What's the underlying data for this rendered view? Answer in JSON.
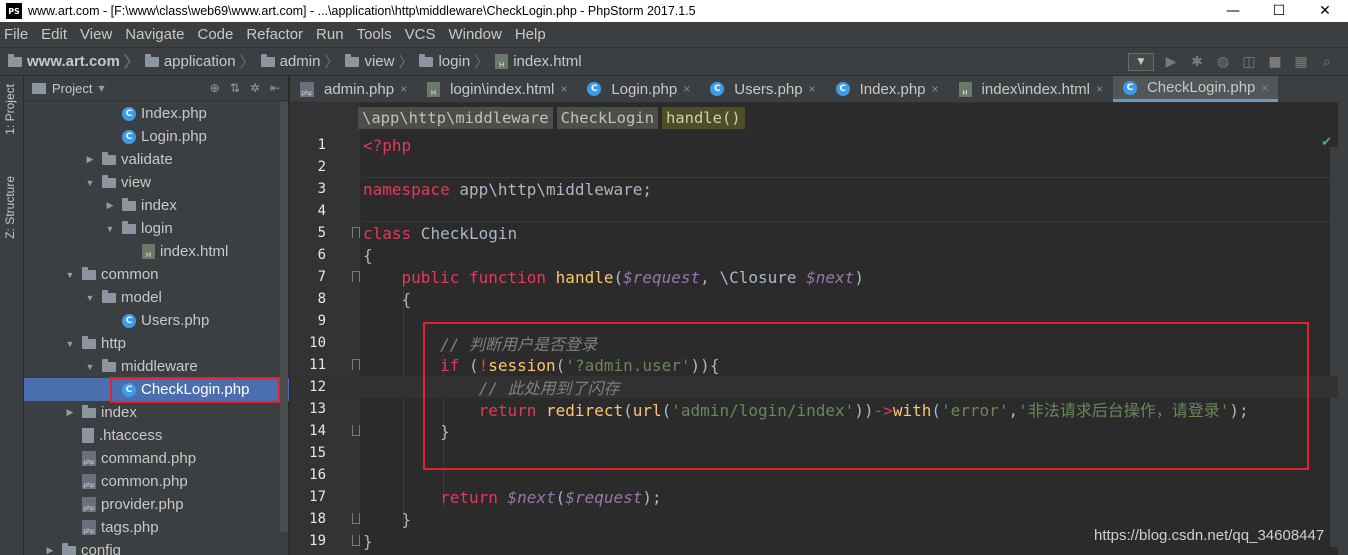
{
  "window": {
    "title": "www.art.com - [F:\\www\\class\\web69\\www.art.com] - ...\\application\\http\\middleware\\CheckLogin.php - PhpStorm 2017.1.5",
    "logo": "PS",
    "minimize": "—",
    "maximize": "☐",
    "close": "✕"
  },
  "menu": [
    "File",
    "Edit",
    "View",
    "Navigate",
    "Code",
    "Refactor",
    "Run",
    "Tools",
    "VCS",
    "Window",
    "Help"
  ],
  "navbar": {
    "crumbs": [
      "www.art.com",
      "application",
      "admin",
      "view",
      "login",
      "index.html"
    ]
  },
  "left_tabs": {
    "project": "1: Project",
    "structure": "Z: Structure"
  },
  "project_panel": {
    "title": "Project",
    "tree": [
      {
        "label": "Index.php",
        "icon": "class-icon",
        "depth": 5,
        "toggle": ""
      },
      {
        "label": "Login.php",
        "icon": "class-icon",
        "depth": 5,
        "toggle": ""
      },
      {
        "label": "validate",
        "icon": "folder-icon",
        "depth": 4,
        "toggle": "▶"
      },
      {
        "label": "view",
        "icon": "folder-icon",
        "depth": 4,
        "toggle": "▼"
      },
      {
        "label": "index",
        "icon": "folder-icon",
        "depth": 5,
        "toggle": "▶"
      },
      {
        "label": "login",
        "icon": "folder-icon",
        "depth": 5,
        "toggle": "▼"
      },
      {
        "label": "index.html",
        "icon": "html-icon",
        "depth": 6,
        "toggle": ""
      },
      {
        "label": "common",
        "icon": "folder-icon",
        "depth": 3,
        "toggle": "▼"
      },
      {
        "label": "model",
        "icon": "folder-icon",
        "depth": 4,
        "toggle": "▼"
      },
      {
        "label": "Users.php",
        "icon": "class-icon",
        "depth": 5,
        "toggle": ""
      },
      {
        "label": "http",
        "icon": "folder-icon",
        "depth": 3,
        "toggle": "▼"
      },
      {
        "label": "middleware",
        "icon": "folder-icon",
        "depth": 4,
        "toggle": "▼"
      },
      {
        "label": "CheckLogin.php",
        "icon": "class-icon",
        "depth": 5,
        "toggle": "",
        "selected": true
      },
      {
        "label": "index",
        "icon": "folder-icon",
        "depth": 3,
        "toggle": "▶"
      },
      {
        "label": ".htaccess",
        "icon": "file-icon",
        "depth": 3,
        "toggle": ""
      },
      {
        "label": "command.php",
        "icon": "php-icon",
        "depth": 3,
        "toggle": ""
      },
      {
        "label": "common.php",
        "icon": "php-icon",
        "depth": 3,
        "toggle": ""
      },
      {
        "label": "provider.php",
        "icon": "php-icon",
        "depth": 3,
        "toggle": ""
      },
      {
        "label": "tags.php",
        "icon": "php-icon",
        "depth": 3,
        "toggle": ""
      },
      {
        "label": "config",
        "icon": "folder-icon",
        "depth": 2,
        "toggle": "▶"
      }
    ]
  },
  "tabs": [
    {
      "label": "admin.php",
      "icon": "php-icon"
    },
    {
      "label": "login\\index.html",
      "icon": "html-icon"
    },
    {
      "label": "Login.php",
      "icon": "class-icon"
    },
    {
      "label": "Users.php",
      "icon": "class-icon"
    },
    {
      "label": "Index.php",
      "icon": "class-icon"
    },
    {
      "label": "index\\index.html",
      "icon": "html-icon"
    },
    {
      "label": "CheckLogin.php",
      "icon": "class-icon",
      "active": true
    }
  ],
  "editor_breadcrumbs": [
    "\\app\\http\\middleware",
    "CheckLogin",
    "handle()"
  ],
  "code_lines": [
    "1",
    "2",
    "3",
    "4",
    "5",
    "6",
    "7",
    "8",
    "9",
    "10",
    "11",
    "12",
    "13",
    "14",
    "15",
    "16",
    "17",
    "18",
    "19"
  ],
  "code": {
    "l1": "<?php",
    "l3_kw": "namespace",
    "l3_rest": " app\\http\\middleware;",
    "l5_kw": "class",
    "l5_rest": " CheckLogin",
    "l6": "{",
    "l7_kw1": "public",
    "l7_kw2": "function",
    "l7_fn": "handle",
    "l7_p1": "(",
    "l7_v1": "$request",
    "l7_p2": ", \\Closure ",
    "l7_v2": "$next",
    "l7_p3": ")",
    "l8": "{",
    "l10": "// 判断用户是否登录",
    "l11_kw": "if",
    "l11_p1": " (",
    "l11_neg": "!",
    "l11_fn": "session",
    "l11_p2": "(",
    "l11_str": "'?admin.user'",
    "l11_p3": ")){",
    "l12": "// 此处用到了闪存",
    "l13_kw": "return",
    "l13_fn1": "redirect",
    "l13_p1": "(",
    "l13_fn2": "url",
    "l13_p2": "(",
    "l13_str1": "'admin/login/index'",
    "l13_p3": "))",
    "l13_arrow": "->",
    "l13_fn3": "with",
    "l13_p4": "(",
    "l13_str2": "'error'",
    "l13_p5": ",",
    "l13_str3": "'非法请求后台操作，请登录'",
    "l13_p6": ");",
    "l14": "}",
    "l17_kw": "return",
    "l17_v1": "$next",
    "l17_p1": "(",
    "l17_v2": "$request",
    "l17_p2": ");",
    "l18": "}",
    "l19": "}"
  },
  "watermark": "https://blog.csdn.net/qq_34608447",
  "colors": {
    "keyword": "#cc7832",
    "string": "#6a8759",
    "function": "#ffc66d",
    "variable": "#9876aa",
    "comment": "#808080",
    "selection": "#4b6eaf",
    "annotation_box": "#e0252a"
  }
}
